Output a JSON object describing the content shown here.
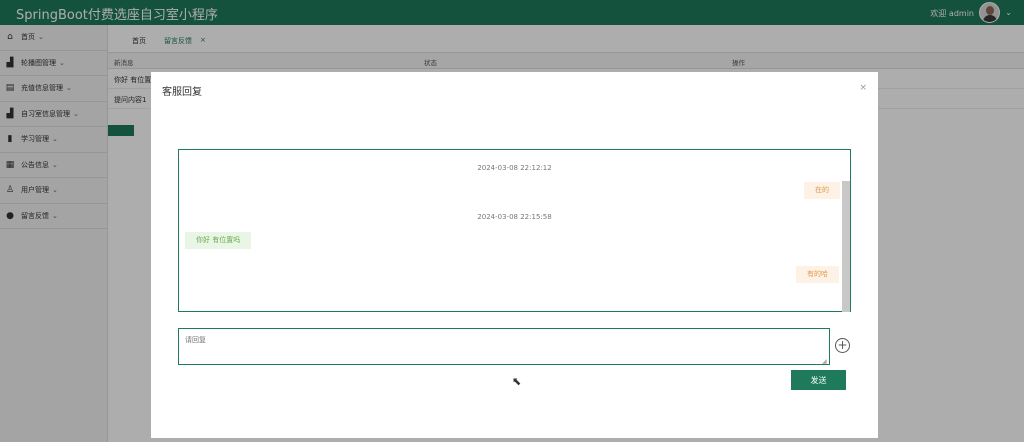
{
  "app": {
    "title": "SpringBoot付费选座自习室小程序"
  },
  "header": {
    "welcome": "欢迎 admin"
  },
  "sidebar": {
    "items": [
      {
        "label": "首页",
        "icon": "home-icon"
      },
      {
        "label": "轮播图管理",
        "icon": "seat-icon"
      },
      {
        "label": "充值信息管理",
        "icon": "list-icon"
      },
      {
        "label": "自习室信息管理",
        "icon": "seat-icon"
      },
      {
        "label": "学习管理",
        "icon": "book-icon"
      },
      {
        "label": "公告信息",
        "icon": "grid-icon"
      },
      {
        "label": "用户管理",
        "icon": "user-icon"
      },
      {
        "label": "留言反馈",
        "icon": "feedback-icon"
      }
    ]
  },
  "tabs": [
    {
      "label": "首页"
    },
    {
      "label": "留言反馈",
      "close": "×"
    }
  ],
  "table": {
    "headers": [
      "新消息",
      "状态",
      "操作"
    ],
    "rows": [
      [
        "你好 有位置"
      ],
      [
        "提问内容1"
      ]
    ]
  },
  "modal": {
    "title": "客服回复",
    "close": "×",
    "messages": [
      {
        "type": "timestamp",
        "text": "2024-03-08 22:12:12"
      },
      {
        "type": "right",
        "text": "在的"
      },
      {
        "type": "timestamp",
        "text": "2024-03-08 22:15:58"
      },
      {
        "type": "left",
        "text": "你好 有位置吗"
      },
      {
        "type": "right",
        "text": "有的哈"
      }
    ],
    "reply_placeholder": "请回复",
    "plus": "+",
    "send_label": "发送"
  },
  "colors": {
    "primary": "#1e7a5a",
    "left_bubble": "#eaf6e5",
    "right_bubble": "#fdf2e5"
  }
}
